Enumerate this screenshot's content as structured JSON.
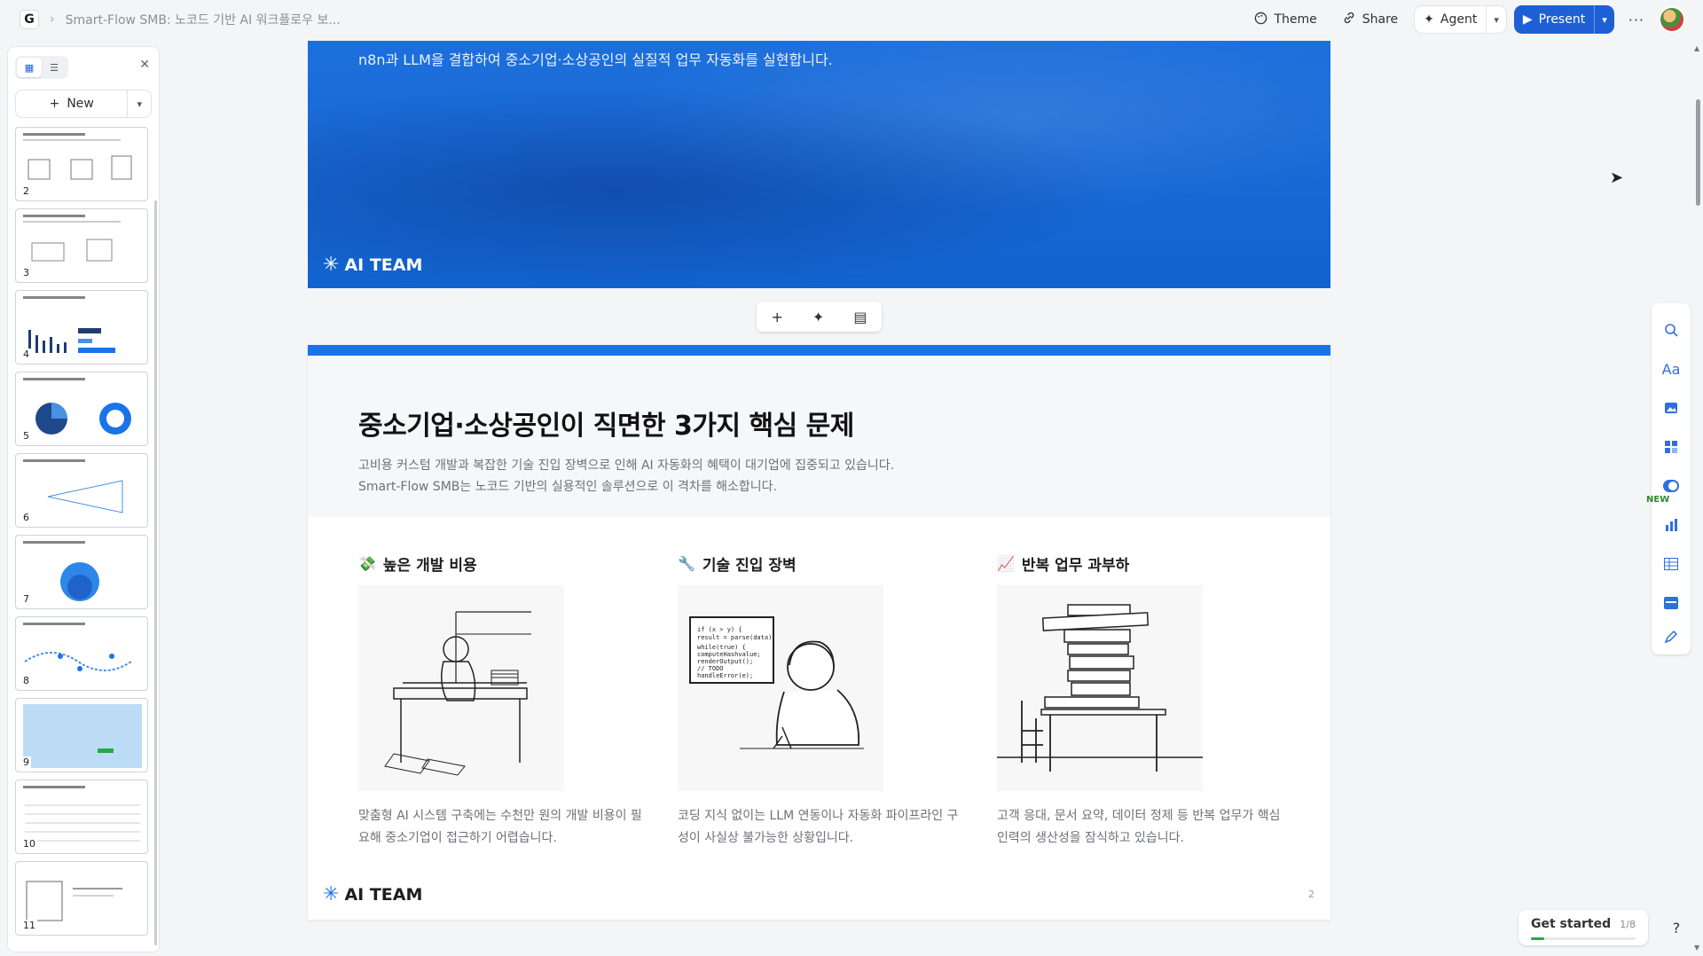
{
  "app": {
    "logo_letter": "G",
    "doc_title": "Smart-Flow SMB: 노코드 기반 AI 워크플로우 보..."
  },
  "toolbar": {
    "theme_label": "Theme",
    "share_label": "Share",
    "agent_label": "Agent",
    "present_label": "Present"
  },
  "sidebar": {
    "new_label": "New",
    "slides": [
      {
        "num": "2"
      },
      {
        "num": "3"
      },
      {
        "num": "4"
      },
      {
        "num": "5"
      },
      {
        "num": "6"
      },
      {
        "num": "7"
      },
      {
        "num": "8"
      },
      {
        "num": "9"
      },
      {
        "num": "10"
      },
      {
        "num": "11"
      }
    ]
  },
  "slide1": {
    "subtitle": "n8n과 LLM을 결합하여 중소기업·소상공인의 실질적 업무 자동화를 실현합니다.",
    "brand": "AI TEAM"
  },
  "slide2": {
    "title": "중소기업·소상공인이 직면한 3가지 핵심 문제",
    "desc_line1": "고비용 커스텀 개발과 복잡한 기술 진입 장벽으로 인해 AI 자동화의 혜택이 대기업에 집중되고 있습니다.",
    "desc_line2": "Smart-Flow SMB는 노코드 기반의 실용적인 솔루션으로 이 격차를 해소합니다.",
    "columns": [
      {
        "icon": "💸",
        "title": "높은 개발 비용",
        "text_line1": "맞춤형 AI 시스템 구축에는 수천만 원의 개발 비용이 필",
        "text_line2": "요해 중소기업이 접근하기 어렵습니다."
      },
      {
        "icon": "🔧",
        "title": "기술 진입 장벽",
        "text_line1": "코딩 지식 없이는 LLM 연동이나 자동화 파이프라인 구",
        "text_line2": "성이 사실상 불가능한 상황입니다.",
        "code_lines": [
          "if (x > y) {",
          "result = parse(data);",
          "while(true) {",
          "computeHashvalue;",
          "renderOutput();",
          "// TODO",
          "handleError(e);"
        ]
      },
      {
        "icon": "📈",
        "title": "반복 업무 과부하",
        "text_line1": "고객 응대, 문서 요약, 데이터 정제 등 반복 업무가 핵심",
        "text_line2": "인력의 생산성을 잠식하고 있습니다."
      }
    ],
    "brand": "AI TEAM",
    "page_num": "2"
  },
  "rail": {
    "new_badge": "NEW"
  },
  "get_started": {
    "label": "Get started",
    "count": "1/8",
    "progress": 0.125
  },
  "colors": {
    "accent": "#1a73e8",
    "present_bg": "#1f5fd6",
    "progress": "#2aa64a"
  }
}
